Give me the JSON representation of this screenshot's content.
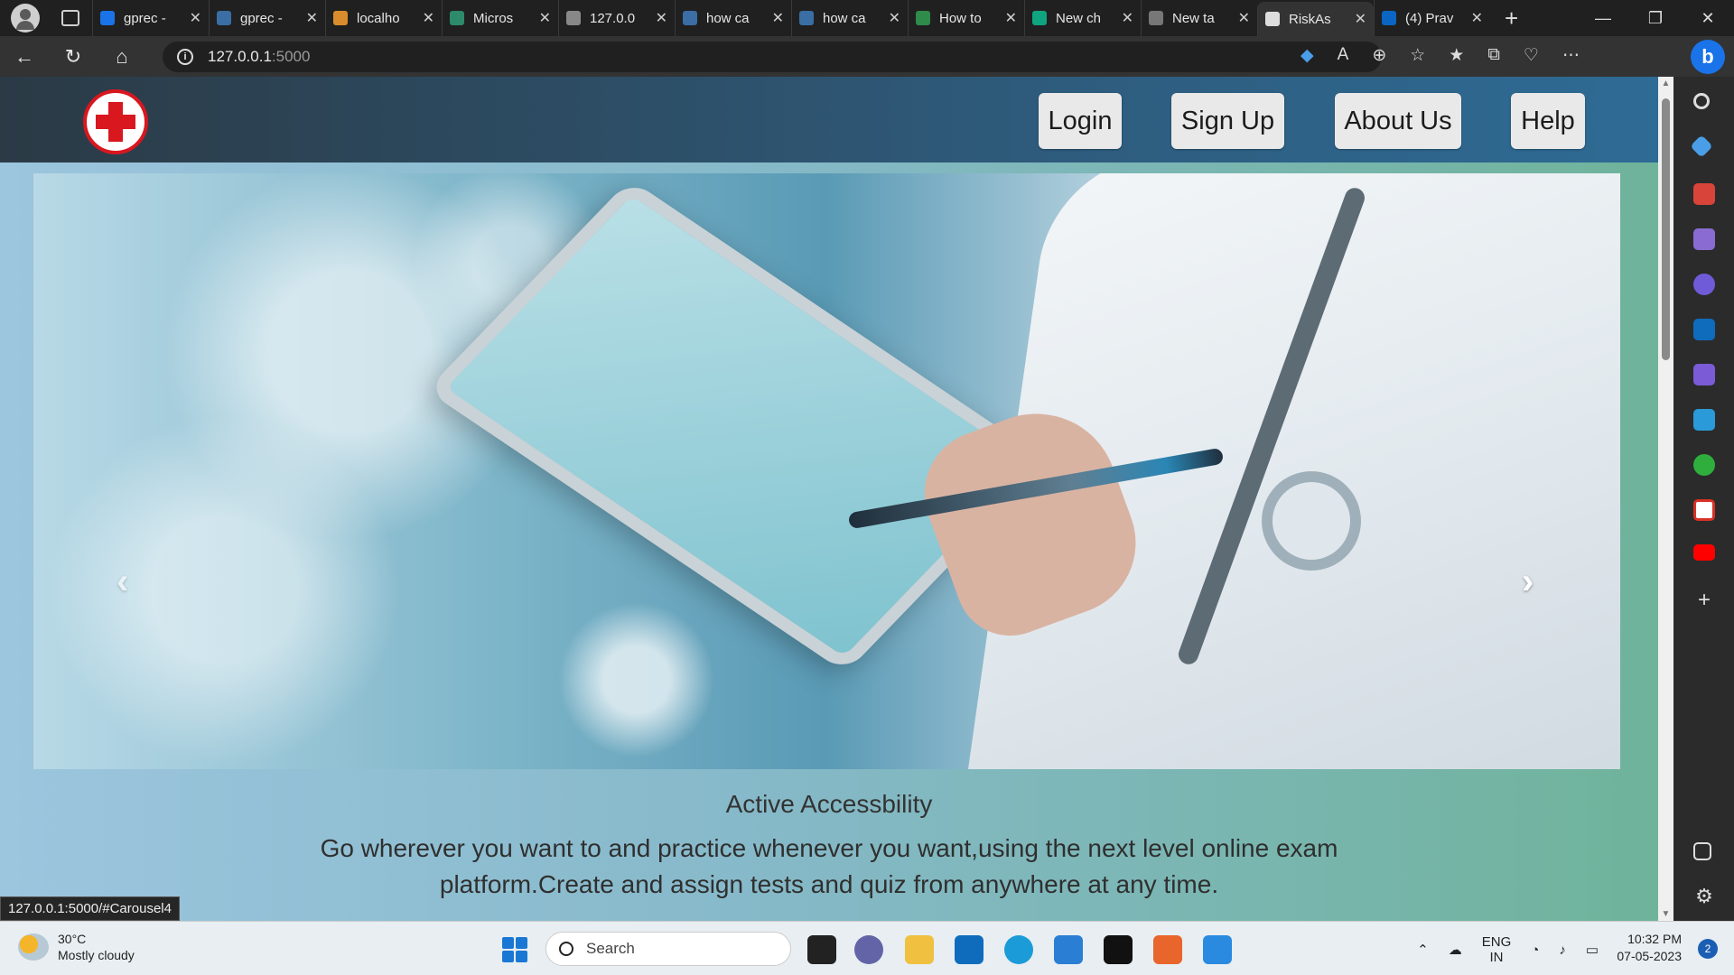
{
  "browser": {
    "tabs": [
      {
        "title": "gprec -",
        "favicon_color": "#1a73e8"
      },
      {
        "title": "gprec -",
        "favicon_color": "#3a6ea5"
      },
      {
        "title": "localho",
        "favicon_color": "#d98c2b"
      },
      {
        "title": "Micros",
        "favicon_color": "#2d8a6a"
      },
      {
        "title": "127.0.0",
        "favicon_color": "#888888"
      },
      {
        "title": "how ca",
        "favicon_color": "#3a6ea5"
      },
      {
        "title": "how ca",
        "favicon_color": "#3a6ea5"
      },
      {
        "title": "How to",
        "favicon_color": "#2f8b4a"
      },
      {
        "title": "New ch",
        "favicon_color": "#10a37f"
      },
      {
        "title": "New ta",
        "favicon_color": "#777777"
      },
      {
        "title": "RiskAs",
        "favicon_color": "#dddddd",
        "active": true
      },
      {
        "title": "(4) Prav",
        "favicon_color": "#0a66c2"
      }
    ],
    "url_host": "127.0.0.1",
    "url_port": ":5000",
    "status_link": "127.0.0.1:5000/#Carousel4"
  },
  "site": {
    "nav": {
      "login": "Login",
      "signup": "Sign Up",
      "about": "About Us",
      "help": "Help"
    },
    "carousel": {
      "prev": "‹",
      "next": "›",
      "caption_title": "Active Accessbility",
      "caption_text": "Go wherever you want to and practice whenever you want,using the next level online exam platform.Create and assign tests and quiz from anywhere at any time."
    }
  },
  "taskbar": {
    "weather_temp": "30°C",
    "weather_desc": "Mostly cloudy",
    "search_placeholder": "Search",
    "language_top": "ENG",
    "language_bottom": "IN",
    "time": "10:32 PM",
    "date": "07-05-2023",
    "notifications": "2"
  },
  "colors": {
    "accent": "#d8171f",
    "nav_bg": "#2e5a7a",
    "page_bg": "#86b9c9"
  }
}
